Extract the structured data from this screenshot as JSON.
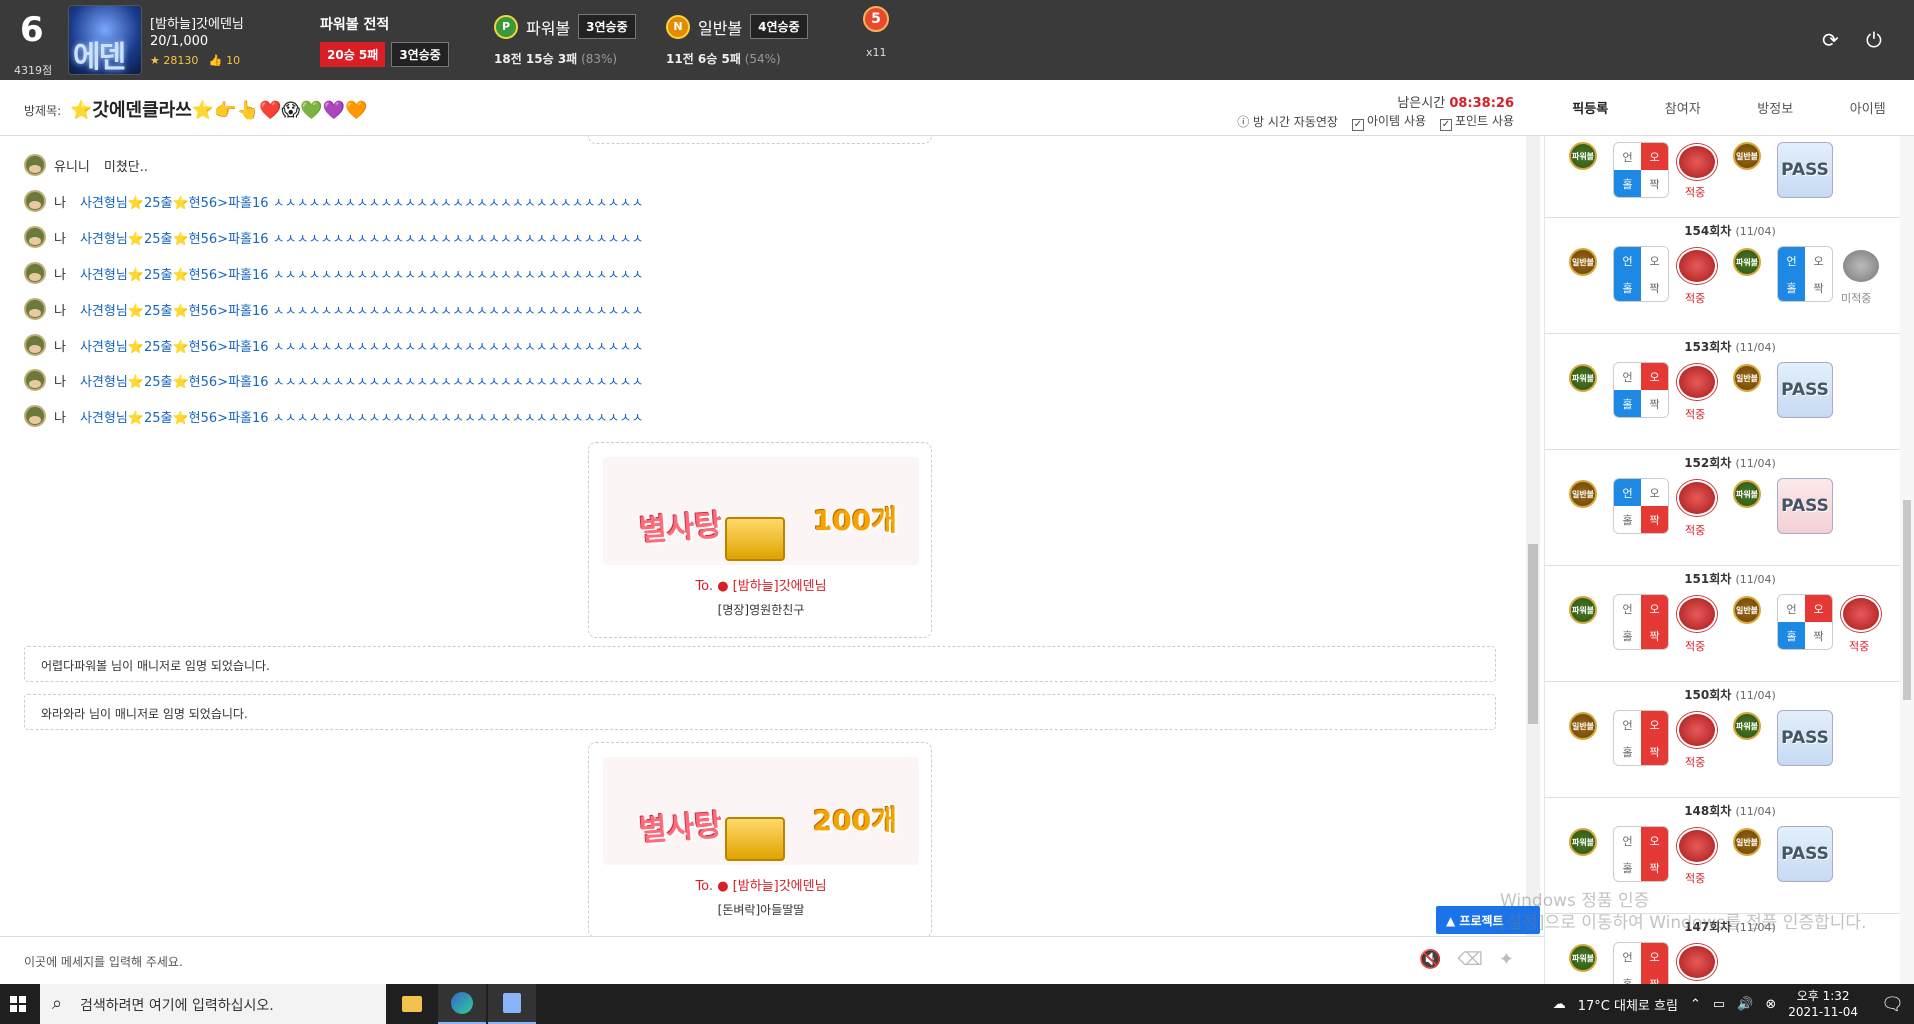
{
  "header": {
    "level": "6",
    "level_points": "4319점",
    "avatar_text": "에덴",
    "username": "[밤하늘]갓에덴님",
    "exp": "20/1,000",
    "coins": "28130",
    "likes": "10",
    "powerball_title": "파워볼 전적",
    "record_badge": "20승 5패",
    "streak_badge": "3연승중",
    "powerball": {
      "icon": "P",
      "name": "파워볼",
      "streak": "3연승중",
      "stat_main": "18전 15승 3패",
      "stat_pct": "(83%)"
    },
    "normalball": {
      "icon": "N",
      "name": "일반볼",
      "streak": "4연승중",
      "stat_main": "11전 6승 5패",
      "stat_pct": "(54%)"
    },
    "medal": "5",
    "medal_count": "x11",
    "icons": [
      "refresh-icon",
      "power-icon"
    ]
  },
  "room": {
    "label": "방제목:",
    "title": "⭐갓에덴클라쓰⭐👉👆❤️😱💚💜🧡",
    "remain_label": "남은시간",
    "remain_time": "08:38:26",
    "opt_extend": "방 시간 자동연장",
    "opt_item": "아이템 사용",
    "opt_point": "포인트 사용"
  },
  "tabs": [
    "픽등록",
    "참여자",
    "방정보",
    "아이템"
  ],
  "chat": {
    "first": {
      "who": "유니니",
      "text": "미쳤단.."
    },
    "repeat_who": "나",
    "repeat_text": "사견형님⭐25출⭐현56>파홀16 ㅅㅅㅅㅅㅅㅅㅅㅅㅅㅅㅅㅅㅅㅅㅅㅅㅅㅅㅅㅅㅅㅅㅅㅅㅅㅅㅅㅅㅅㅅㅅ",
    "gifts": [
      {
        "name": "별사탕",
        "count": "100개",
        "to_label": "To.",
        "to": "[밤하늘]갓에덴님",
        "from": "[명장]영원한친구"
      },
      {
        "name": "별사탕",
        "count": "200개",
        "to_label": "To.",
        "to": "[밤하늘]갓에덴님",
        "from": "[돈벼락]아들딸딸"
      }
    ],
    "notices": [
      "어렵다파워볼 님이 매니저로 임명 되었습니다.",
      "와라와라 님이 매니저로 임명 되었습니다."
    ],
    "input_placeholder": "이곳에 메세지를 입력해 주세요.",
    "project_btn": "▲ 프로젝트"
  },
  "rounds": [
    {
      "label": "154회차",
      "date": "(11/04)"
    },
    {
      "label": "153회차",
      "date": "(11/04)"
    },
    {
      "label": "152회차",
      "date": "(11/04)"
    },
    {
      "label": "151회차",
      "date": "(11/04)"
    },
    {
      "label": "150회차",
      "date": "(11/04)"
    },
    {
      "label": "148회차",
      "date": "(11/04)"
    },
    {
      "label": "147회차",
      "date": "(11/04)"
    }
  ],
  "side_labels": {
    "pb": "파워볼",
    "nb": "일반볼",
    "hit": "적중",
    "miss": "미적중",
    "pass": "PASS",
    "c1": "언",
    "c2": "오",
    "c3": "홀",
    "c4": "짝"
  },
  "watermark": {
    "line1": "Windows 정품 인증",
    "line2": "[설정]으로 이동하여 Windows를 정품 인증합니다."
  },
  "taskbar": {
    "search": "검색하려면 여기에 입력하십시오.",
    "weather": "17°C 대체로 흐림",
    "time": "오후 1:32",
    "date": "2021-11-04"
  }
}
